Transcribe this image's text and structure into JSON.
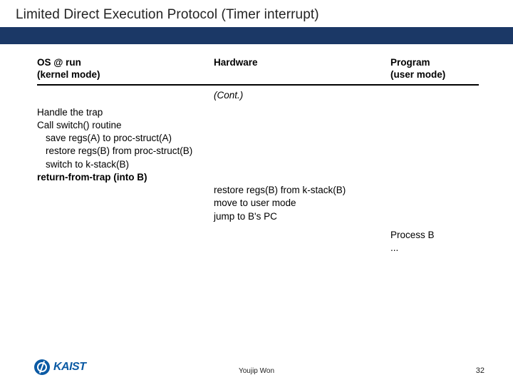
{
  "title": "Limited Direct Execution Protocol (Timer interrupt)",
  "headers": {
    "col1_line1": "OS @ run",
    "col1_line2": "(kernel mode)",
    "col2": "Hardware",
    "col3_line1": "Program",
    "col3_line2": "(user mode)"
  },
  "cont": "(Cont.)",
  "os": {
    "l1": "Handle the trap",
    "l2": "Call switch() routine",
    "l3": "save regs(A) to proc-struct(A)",
    "l4": "restore regs(B) from proc-struct(B)",
    "l5": "switch to k-stack(B)",
    "l6": "return-from-trap (into B)"
  },
  "hw": {
    "l1": "restore regs(B) from k-stack(B)",
    "l2": "move to user mode",
    "l3": "jump to B's PC"
  },
  "prog": {
    "l1": "Process B",
    "l2": "..."
  },
  "logo_text": "KAIST",
  "author": "Youjip Won",
  "page": "32"
}
